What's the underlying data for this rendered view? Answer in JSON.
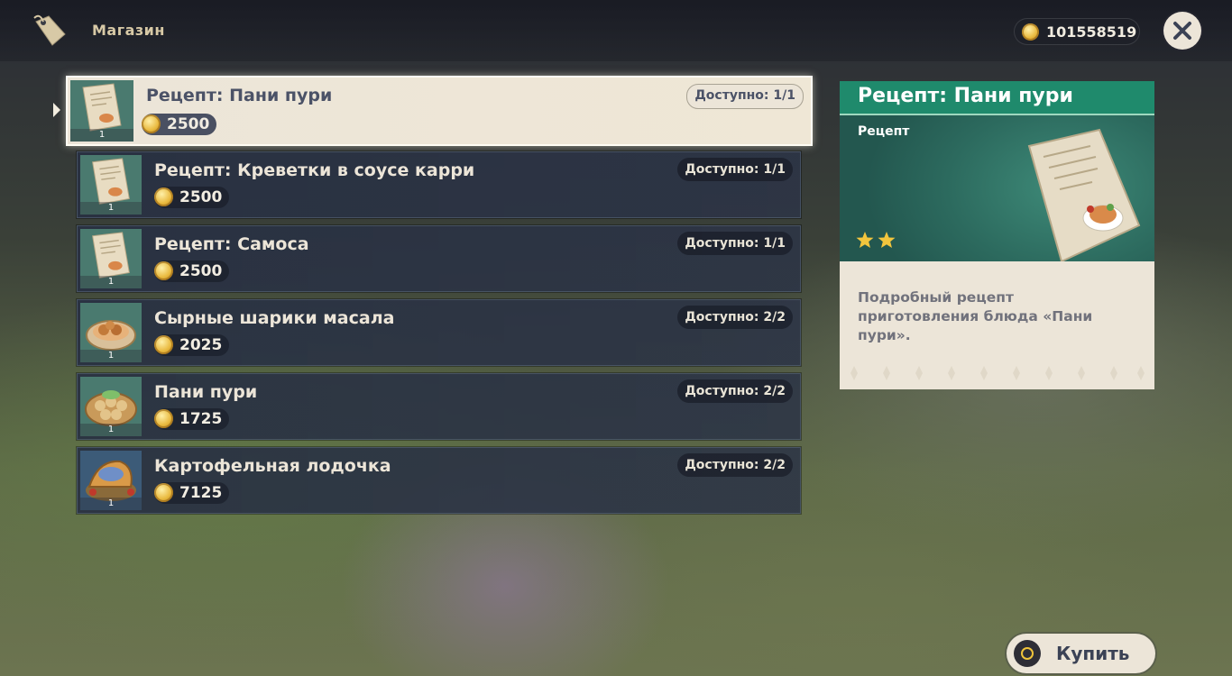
{
  "header": {
    "title": "Магазин",
    "currency_value": "101558519"
  },
  "items": [
    {
      "name": "Рецепт: Пани пури",
      "price": "2500",
      "availability": "Доступно: 1/1",
      "quantity": "1",
      "icon": "recipe-icon",
      "selected": true
    },
    {
      "name": "Рецепт: Креветки в соусе карри",
      "price": "2500",
      "availability": "Доступно: 1/1",
      "quantity": "1",
      "icon": "recipe-icon"
    },
    {
      "name": "Рецепт: Самоса",
      "price": "2500",
      "availability": "Доступно: 1/1",
      "quantity": "1",
      "icon": "recipe-icon"
    },
    {
      "name": "Сырные шарики масала",
      "price": "2025",
      "availability": "Доступно: 2/2",
      "quantity": "1",
      "icon": "dish-icon"
    },
    {
      "name": "Пани пури",
      "price": "1725",
      "availability": "Доступно: 2/2",
      "quantity": "1",
      "icon": "dish-icon"
    },
    {
      "name": "Картофельная лодочка",
      "price": "7125",
      "availability": "Доступно: 2/2",
      "quantity": "1",
      "icon": "dish-icon"
    }
  ],
  "detail": {
    "title": "Рецепт: Пани пури",
    "type": "Рецепт",
    "rarity_stars": 2,
    "description": "Подробный рецепт приготовления блюда «Пани пури»."
  },
  "buy_button": {
    "label": "Купить"
  },
  "colors": {
    "detail_header": "#1f8a6c",
    "panel_cream": "#ece5d8",
    "coin_gold": "#e9b93e",
    "star_gold": "#f2c53d"
  }
}
